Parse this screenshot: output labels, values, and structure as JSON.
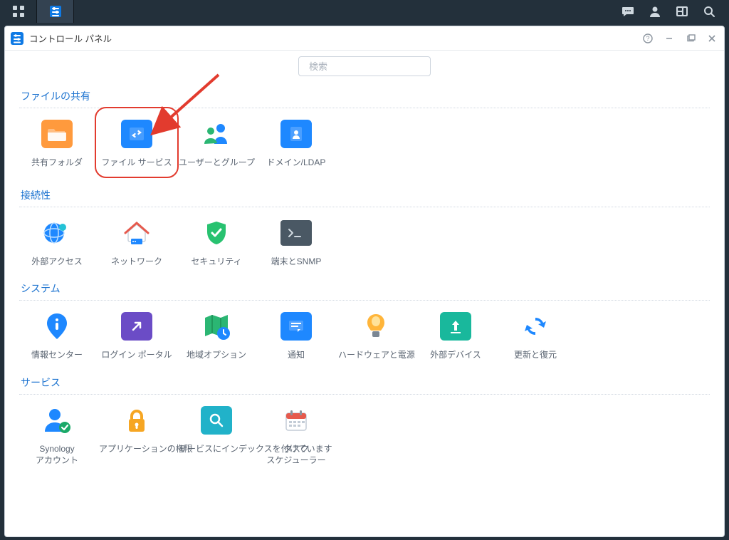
{
  "window": {
    "title": "コントロール パネル"
  },
  "search": {
    "placeholder": "検索"
  },
  "sections": {
    "file_sharing": {
      "title": "ファイルの共有",
      "items": [
        {
          "label": "共有フォルダ"
        },
        {
          "label": "ファイル サービス"
        },
        {
          "label": "ユーザーとグループ"
        },
        {
          "label": "ドメイン/LDAP"
        }
      ]
    },
    "connectivity": {
      "title": "接続性",
      "items": [
        {
          "label": "外部アクセス"
        },
        {
          "label": "ネットワーク"
        },
        {
          "label": "セキュリティ"
        },
        {
          "label": "端末とSNMP"
        }
      ]
    },
    "system": {
      "title": "システム",
      "items": [
        {
          "label": "情報センター"
        },
        {
          "label": "ログイン ポータル"
        },
        {
          "label": "地域オプション"
        },
        {
          "label": "通知"
        },
        {
          "label": "ハードウェアと電源"
        },
        {
          "label": "外部デバイス"
        },
        {
          "label": "更新と復元"
        }
      ]
    },
    "services": {
      "title": "サービス",
      "items": [
        {
          "label": "Synology アカウント"
        },
        {
          "label": "アプリケーションの権限"
        },
        {
          "label": "サービスにインデックスを付けています"
        },
        {
          "label": "タスク スケジューラー"
        }
      ]
    }
  }
}
